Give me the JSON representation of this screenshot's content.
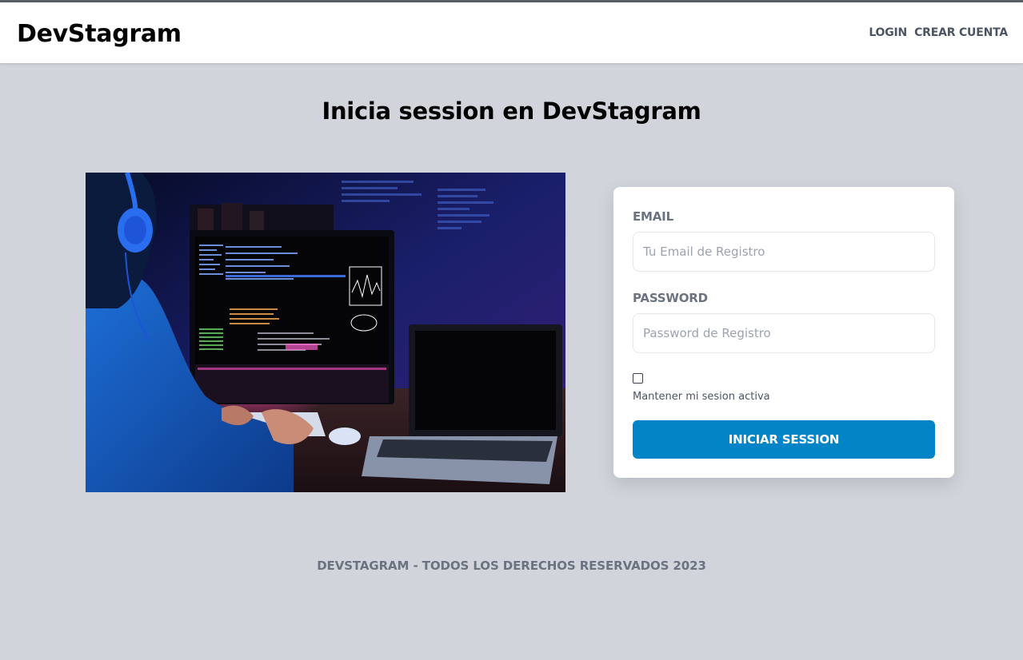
{
  "header": {
    "logo": "DevStagram",
    "nav": [
      {
        "label": "LOGIN"
      },
      {
        "label": "CREAR CUENTA"
      }
    ]
  },
  "main": {
    "title": "Inicia session en DevStagram",
    "hero_image": {
      "icon": "developer-at-computer-photo"
    }
  },
  "form": {
    "email_label": "EMAIL",
    "email_placeholder": "Tu Email de Registro",
    "email_value": "",
    "password_label": "PASSWORD",
    "password_placeholder": "Password de Registro",
    "password_value": "",
    "remember_checked": false,
    "remember_label": "Mantener mi sesion activa",
    "submit_label": "INICIAR SESSION"
  },
  "footer": {
    "text": "DEVSTAGRAM - TODOS LOS DERECHOS RESERVADOS 2023"
  },
  "colors": {
    "page_background": "#d1d5db",
    "primary_button": "#0284c7",
    "label_gray": "#6b7280"
  }
}
